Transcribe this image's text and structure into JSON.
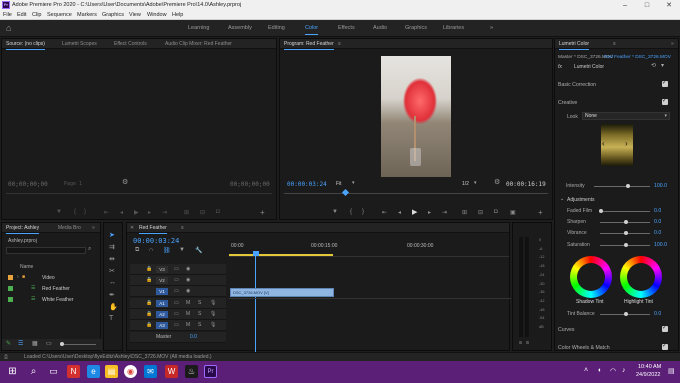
{
  "window": {
    "title": "Adobe Premiere Pro 2020 - C:\\Users\\User\\Documents\\Adobe\\Premiere Pro\\14.0\\Ashley.prproj"
  },
  "menu": [
    "File",
    "Edit",
    "Clip",
    "Sequence",
    "Markers",
    "Graphics",
    "View",
    "Window",
    "Help"
  ],
  "workspaces": [
    "Learning",
    "Assembly",
    "Editing",
    "Color",
    "Effects",
    "Audio",
    "Graphics",
    "Libraries"
  ],
  "active_workspace": "Color",
  "source": {
    "tabs": [
      "Source: (no clips)",
      "Lumetri Scopes",
      "Effect Controls",
      "Audio Clip Mixer: Red Feather"
    ],
    "timecode_left": "00;00;00;00",
    "page": "Page 1",
    "timecode_right": "00;00;00;00"
  },
  "program": {
    "tab": "Program: Red Feather",
    "timecode": "00:00:03:24",
    "fit": "Fit",
    "resolution": "1/2",
    "duration": "00:00:16:19"
  },
  "project": {
    "tabs": [
      "Project: Ashley",
      "Media Bro"
    ],
    "file": "Ashley.prproj",
    "column_name": "Name",
    "items": [
      {
        "name": "Video",
        "type": "bin",
        "color": "#e8a33d"
      },
      {
        "name": "Red Feather",
        "type": "sequence",
        "color": "#4caf50"
      },
      {
        "name": "White Feather",
        "type": "sequence",
        "color": "#4caf50"
      }
    ]
  },
  "timeline": {
    "tab": "Red Feather",
    "timecode": "00:00:03:24",
    "ruler": [
      "00:00",
      "00:00:15:00",
      "00:00:30:00"
    ],
    "video_tracks": [
      "V3",
      "V2",
      "V1"
    ],
    "audio_tracks": [
      "A1",
      "A2",
      "A3"
    ],
    "master_label": "Master",
    "master_value": "0.0",
    "clip_label": "DSC_3726.MOV [V]"
  },
  "audio_meter": {
    "ticks": [
      "0",
      "-6",
      "-12",
      "-18",
      "-24",
      "-30",
      "-36",
      "-42",
      "-48",
      "-54",
      "dB"
    ],
    "solo": [
      "S",
      "S"
    ]
  },
  "lumetri": {
    "tab": "Lumetri Color",
    "master": "Master * DSC_3726.MOV",
    "sequence_clip": "Red Feather * DSC_3726.MOV",
    "fx_label": "fx",
    "fx_name": "Lumetri Color",
    "basic": "Basic Correction",
    "creative": "Creative",
    "look_label": "Look",
    "look_value": "None",
    "intensity_label": "Intensity",
    "intensity_value": "100.0",
    "adjustments": "Adjustments",
    "sliders": [
      {
        "label": "Faded Film",
        "value": "0.0",
        "pos": 0.0
      },
      {
        "label": "Sharpen",
        "value": "0.0",
        "pos": 0.5
      },
      {
        "label": "Vibrance",
        "value": "0.0",
        "pos": 0.5
      },
      {
        "label": "Saturation",
        "value": "100.0",
        "pos": 0.5
      }
    ],
    "shadow_tint": "Shadow Tint",
    "highlight_tint": "Highlight Tint",
    "tint_balance_label": "Tint Balance",
    "tint_balance_value": "0.0",
    "curves": "Curves",
    "color_wheels": "Color Wheels & Match"
  },
  "status": {
    "text": "Loaded C:\\Users\\User\\Desktop\\flyeEditz\\Ashley\\DSC_3726.MOV (All media loaded.)"
  },
  "taskbar": {
    "time": "10:40 AM",
    "date": "24/9/2022"
  }
}
